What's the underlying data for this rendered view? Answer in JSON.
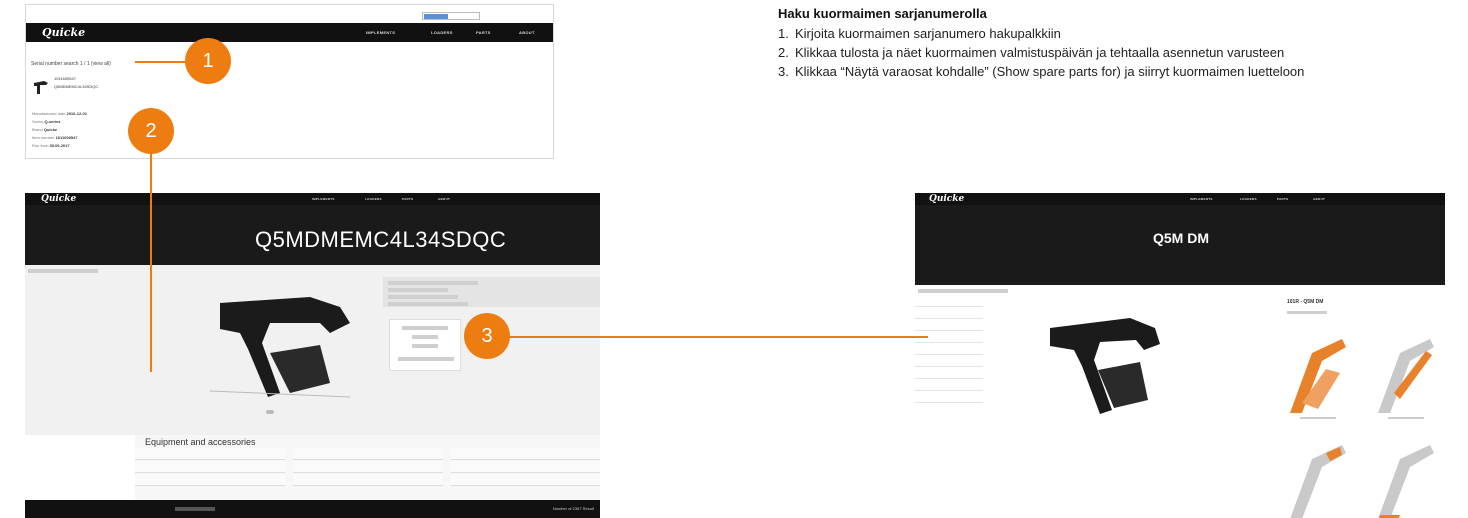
{
  "instructions": {
    "title": "Haku kuormaimen sarjanumerolla",
    "steps": [
      {
        "num": "1.",
        "text": "Kirjoita kuormaimen sarjanumero hakupalkkiin"
      },
      {
        "num": "2.",
        "text": "Klikkaa tulosta ja näet kuormaimen valmistuspäivän ja tehtaalla asennetun varusteen"
      },
      {
        "num": "3.",
        "text": "Klikkaa “Näytä varaosat kohdalle” (Show spare parts for) ja siirryt kuormaimen luetteloon"
      }
    ]
  },
  "badges": [
    "1",
    "2",
    "3"
  ],
  "brand": "Quicke",
  "nav": [
    "IMPLEMENTS",
    "LOADERS",
    "PARTS",
    "ABOUT"
  ],
  "shot1": {
    "result_heading": "Serial number search 1 / 1 (view all)",
    "result_code": "1011600547",
    "result_serial": "Q5MDMEMC4L34SDQC",
    "details": [
      {
        "label": "Manufactured date",
        "value": "2016-12-01"
      },
      {
        "label": "Series",
        "value": "Q-series"
      },
      {
        "label": "Brand",
        "value": "Quicke"
      },
      {
        "label": "Item number",
        "value": "1011600547"
      },
      {
        "label": "Run from",
        "value": "30.06.2017"
      }
    ]
  },
  "shot2": {
    "serial_title": "Q5MDMEMC4L34SDQC",
    "section_title": "Equipment and accessories",
    "footer_right": "Number of 2367 Result"
  },
  "shot3": {
    "model_title": "Q5M DM",
    "parts_title": "101R - Q5M DM"
  },
  "colors": {
    "accent": "#ee7d11",
    "dark": "#111111"
  }
}
